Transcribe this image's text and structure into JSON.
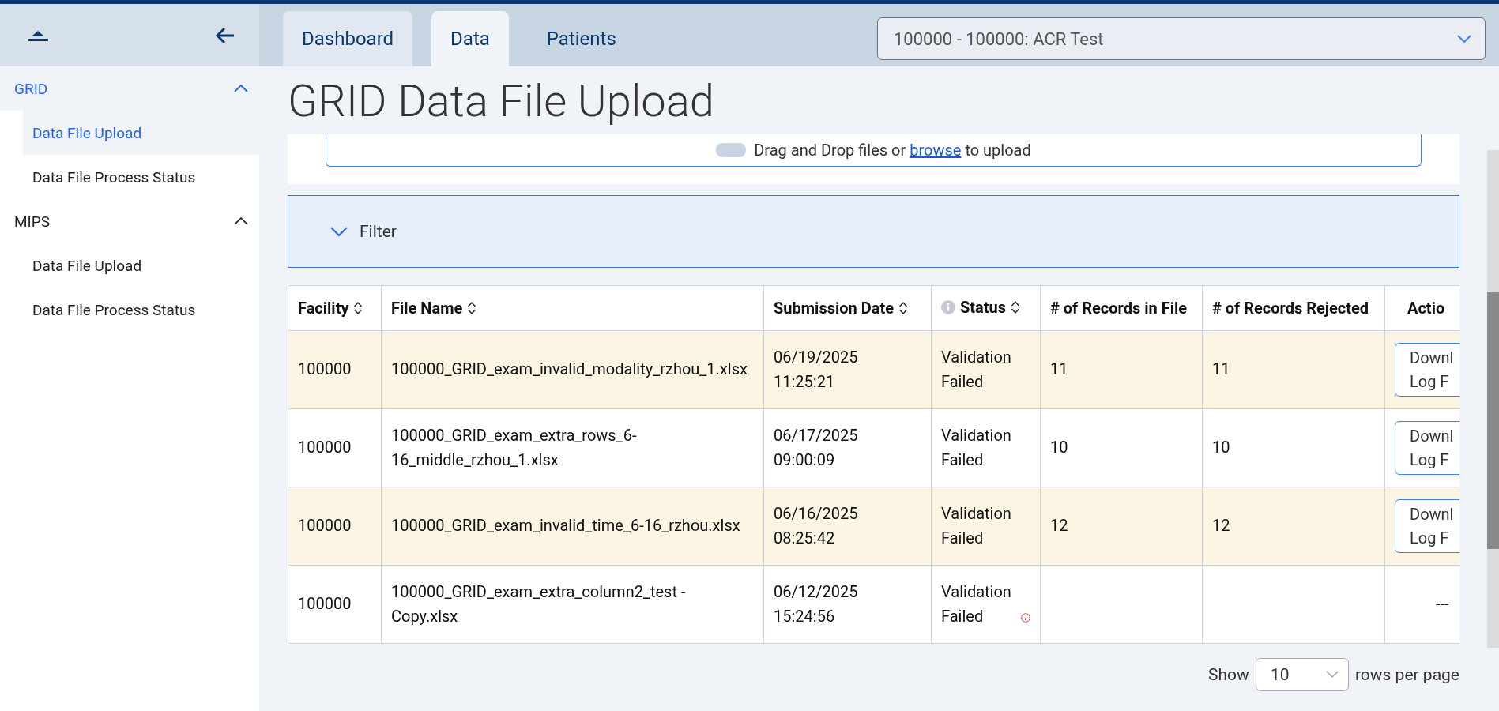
{
  "sidebar": {
    "groups": [
      {
        "label": "GRID",
        "active": true,
        "expanded": true,
        "items": [
          {
            "label": "Data File Upload",
            "selected": true
          },
          {
            "label": "Data File Process Status",
            "selected": false
          }
        ]
      },
      {
        "label": "MIPS",
        "active": false,
        "expanded": true,
        "items": [
          {
            "label": "Data File Upload",
            "selected": false
          },
          {
            "label": "Data File Process Status",
            "selected": false
          }
        ]
      }
    ]
  },
  "tabs": [
    {
      "label": "Dashboard",
      "selected": false,
      "hovered": true
    },
    {
      "label": "Data",
      "selected": true,
      "hovered": false
    },
    {
      "label": "Patients",
      "selected": false,
      "hovered": false
    }
  ],
  "facility_select": {
    "value": "100000 - 100000: ACR Test"
  },
  "page_title": "GRID Data File Upload",
  "upload": {
    "text_before": "Drag and Drop files or ",
    "link": "browse",
    "text_after": " to upload"
  },
  "filter": {
    "label": "Filter",
    "expanded": false
  },
  "table": {
    "columns": [
      {
        "label": "Facility",
        "sortable": true,
        "info": false
      },
      {
        "label": "File Name",
        "sortable": true,
        "info": false
      },
      {
        "label": "Submission Date",
        "sortable": true,
        "info": false
      },
      {
        "label": "Status",
        "sortable": true,
        "info": true
      },
      {
        "label": "# of Records in File",
        "sortable": false,
        "info": false
      },
      {
        "label": "# of Records Rejected",
        "sortable": false,
        "info": false
      },
      {
        "label": "Actio",
        "sortable": false,
        "info": false
      }
    ],
    "rows": [
      {
        "highlighted": true,
        "facility": "100000",
        "file_name": "100000_GRID_exam_invalid_modality_rzhou_1.xlsx",
        "date": "06/19/2025",
        "time": "11:25:21",
        "status": "Validation Failed",
        "error_icon": false,
        "records": "11",
        "rejected": "11",
        "action": {
          "kind": "button",
          "label": "Downl\nLog F"
        }
      },
      {
        "highlighted": false,
        "facility": "100000",
        "file_name": "100000_GRID_exam_extra_rows_6-16_middle_rzhou_1.xlsx",
        "date": "06/17/2025",
        "time": "09:00:09",
        "status": "Validation Failed",
        "error_icon": false,
        "records": "10",
        "rejected": "10",
        "action": {
          "kind": "button",
          "label": "Downl\nLog F"
        }
      },
      {
        "highlighted": true,
        "facility": "100000",
        "file_name": "100000_GRID_exam_invalid_time_6-16_rzhou.xlsx",
        "date": "06/16/2025",
        "time": "08:25:42",
        "status": "Validation Failed",
        "error_icon": false,
        "records": "12",
        "rejected": "12",
        "action": {
          "kind": "button",
          "label": "Downl\nLog F"
        }
      },
      {
        "highlighted": false,
        "facility": "100000",
        "file_name": "100000_GRID_exam_extra_column2_test - Copy.xlsx",
        "date": "06/12/2025",
        "time": "15:24:56",
        "status": "Validation Failed",
        "error_icon": true,
        "records": "",
        "rejected": "",
        "action": {
          "kind": "text",
          "label": "---"
        }
      }
    ]
  },
  "pagination": {
    "show_label": "Show",
    "page_size": "10",
    "suffix": "rows per page"
  }
}
